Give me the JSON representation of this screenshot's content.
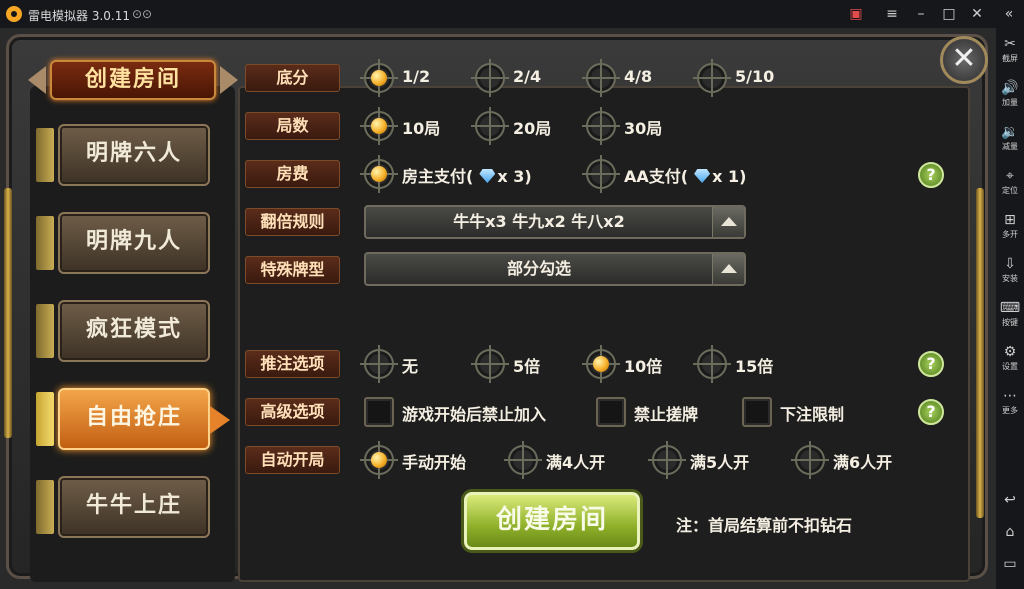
{
  "window": {
    "title": "雷电模拟器 3.0.11",
    "controls": [
      "gift-icon",
      "menu-icon",
      "minimize-icon",
      "maximize-icon",
      "close-icon"
    ]
  },
  "sidebar": {
    "items": [
      {
        "icon": "scissors-icon",
        "glyph": "✂",
        "label": "截屏"
      },
      {
        "icon": "volume-up-icon",
        "glyph": "🔊",
        "label": "加量"
      },
      {
        "icon": "volume-down-icon",
        "glyph": "🔉",
        "label": "减量"
      },
      {
        "icon": "location-icon",
        "glyph": "⌖",
        "label": "定位"
      },
      {
        "icon": "multi-open-icon",
        "glyph": "⊞",
        "label": "多开"
      },
      {
        "icon": "apk-install-icon",
        "glyph": "⇩",
        "label": "安装"
      },
      {
        "icon": "keyboard-icon",
        "glyph": "⌨",
        "label": "按键"
      },
      {
        "icon": "settings-icon",
        "glyph": "⚙",
        "label": "设置"
      },
      {
        "icon": "more-icon",
        "glyph": "⋯",
        "label": "更多"
      }
    ],
    "nav": [
      {
        "icon": "back-icon",
        "glyph": "↩"
      },
      {
        "icon": "home-icon",
        "glyph": "⌂"
      },
      {
        "icon": "recents-icon",
        "glyph": "▭"
      }
    ]
  },
  "header": {
    "title": "创建房间",
    "close_glyph": "✕"
  },
  "modes": [
    {
      "label": "明牌六人",
      "active": false
    },
    {
      "label": "明牌九人",
      "active": false
    },
    {
      "label": "疯狂模式",
      "active": false
    },
    {
      "label": "自由抢庄",
      "active": true
    },
    {
      "label": "牛牛上庄",
      "active": false
    }
  ],
  "options": {
    "base_score": {
      "label": "底分",
      "choices": [
        "1/2",
        "2/4",
        "4/8",
        "5/10"
      ],
      "selected": "1/2"
    },
    "rounds": {
      "label": "局数",
      "choices": [
        "10局",
        "20局",
        "30局"
      ],
      "selected": "10局"
    },
    "room_fee": {
      "label": "房费",
      "choices": [
        {
          "text": "房主支付",
          "paren_open": "(",
          "gem_icon": "diamond-icon",
          "cost": "x 3",
          "paren_close": ")"
        },
        {
          "text": "AA支付",
          "paren_open": "(",
          "gem_icon": "diamond-icon",
          "cost": "x 1",
          "paren_close": ")"
        }
      ],
      "selected": "房主支付"
    },
    "double_rule": {
      "label": "翻倍规则",
      "value": "牛牛x3  牛九x2  牛八x2"
    },
    "special_cards": {
      "label": "特殊牌型",
      "value": "部分勾选"
    },
    "push_bet": {
      "label": "推注选项",
      "choices": [
        "无",
        "5倍",
        "10倍",
        "15倍"
      ],
      "selected": "10倍"
    },
    "advanced": {
      "label": "高级选项",
      "checkboxes": [
        {
          "text": "游戏开始后禁止加入",
          "checked": false
        },
        {
          "text": "禁止搓牌",
          "checked": false
        },
        {
          "text": "下注限制",
          "checked": false
        }
      ]
    },
    "auto_start": {
      "label": "自动开局",
      "choices": [
        "手动开始",
        "满4人开",
        "满5人开",
        "满6人开"
      ],
      "selected": "手动开始"
    }
  },
  "help_glyph": "?",
  "create_button": {
    "label": "创建房间"
  },
  "note": "注：首局结算前不扣钻石"
}
